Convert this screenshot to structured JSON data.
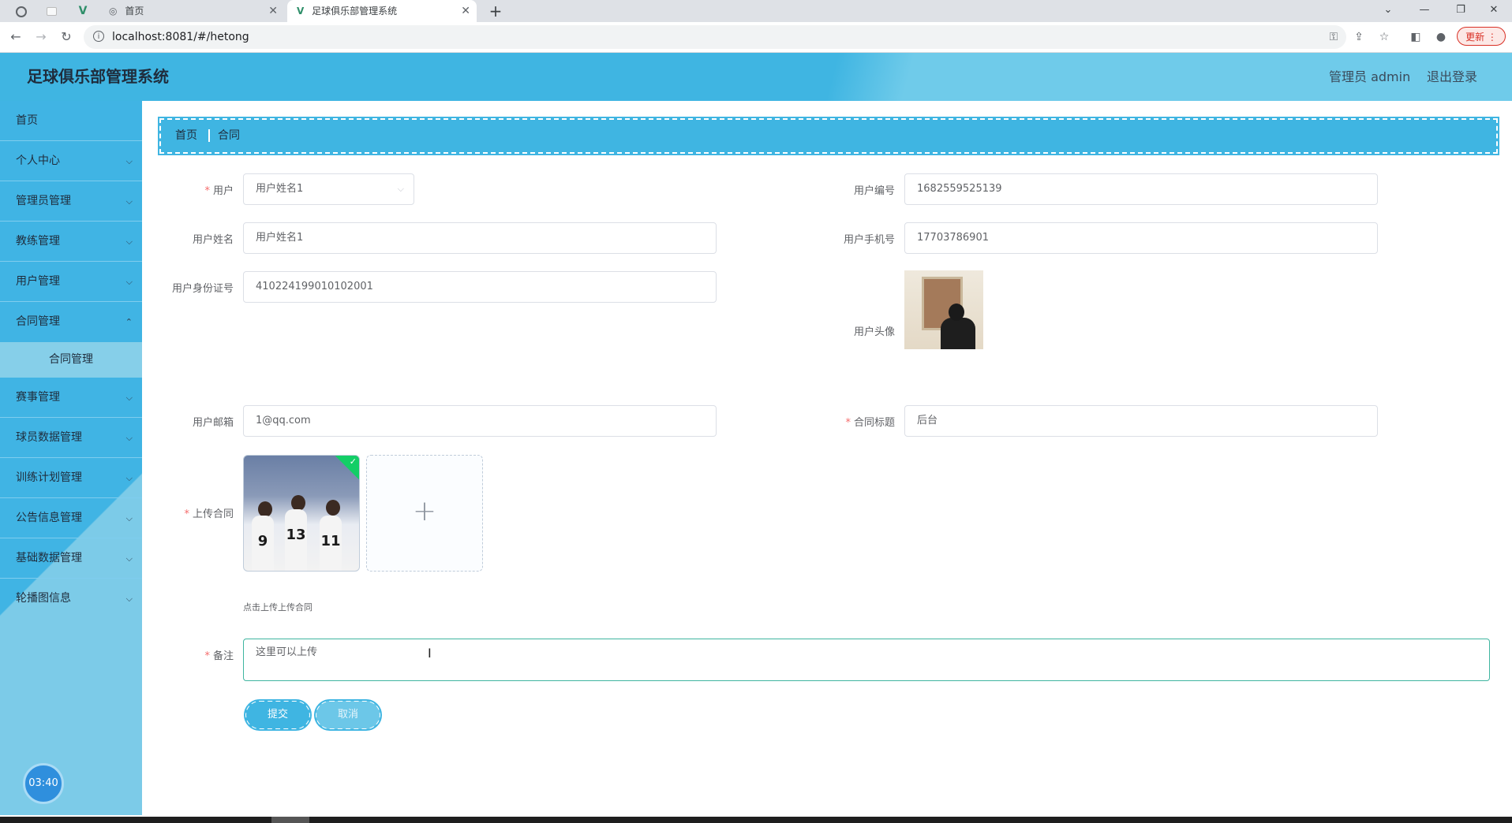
{
  "browser": {
    "tabs": [
      {
        "label": "首页"
      },
      {
        "label": "足球俱乐部管理系统"
      }
    ],
    "url": "localhost:8081/#/hetong",
    "update_label": "更新"
  },
  "header": {
    "title": "足球俱乐部管理系统",
    "user": "管理员 admin",
    "logout": "退出登录"
  },
  "sidebar": {
    "items": [
      {
        "label": "首页"
      },
      {
        "label": "个人中心"
      },
      {
        "label": "管理员管理"
      },
      {
        "label": "教练管理"
      },
      {
        "label": "用户管理"
      },
      {
        "label": "合同管理"
      },
      {
        "label": "合同管理"
      },
      {
        "label": "赛事管理"
      },
      {
        "label": "球员数据管理"
      },
      {
        "label": "训练计划管理"
      },
      {
        "label": "公告信息管理"
      },
      {
        "label": "基础数据管理"
      },
      {
        "label": "轮播图信息"
      }
    ],
    "timer": "03:40"
  },
  "breadcrumb": {
    "home": "首页",
    "current": "合同"
  },
  "form": {
    "user": {
      "label": "用户",
      "value": "用户姓名1"
    },
    "user_no": {
      "label": "用户编号",
      "value": "1682559525139"
    },
    "user_name": {
      "label": "用户姓名",
      "value": "用户姓名1"
    },
    "user_phone": {
      "label": "用户手机号",
      "value": "17703786901"
    },
    "user_id_card": {
      "label": "用户身份证号",
      "value": "410224199010102001"
    },
    "user_avatar": {
      "label": "用户头像"
    },
    "user_email": {
      "label": "用户邮箱",
      "value": "1@qq.com"
    },
    "contract_title": {
      "label": "合同标题",
      "value": "后台"
    },
    "upload": {
      "label": "上传合同",
      "hint": "点击上传上传合同",
      "player_numbers": [
        "9",
        "13",
        "11"
      ]
    },
    "remark": {
      "label": "备注",
      "value": "这里可以上传"
    },
    "submit_label": "提交",
    "cancel_label": "取消"
  },
  "colors": {
    "accent": "#3fb5e2",
    "required": "#f56c6c",
    "success": "#13ce66"
  }
}
